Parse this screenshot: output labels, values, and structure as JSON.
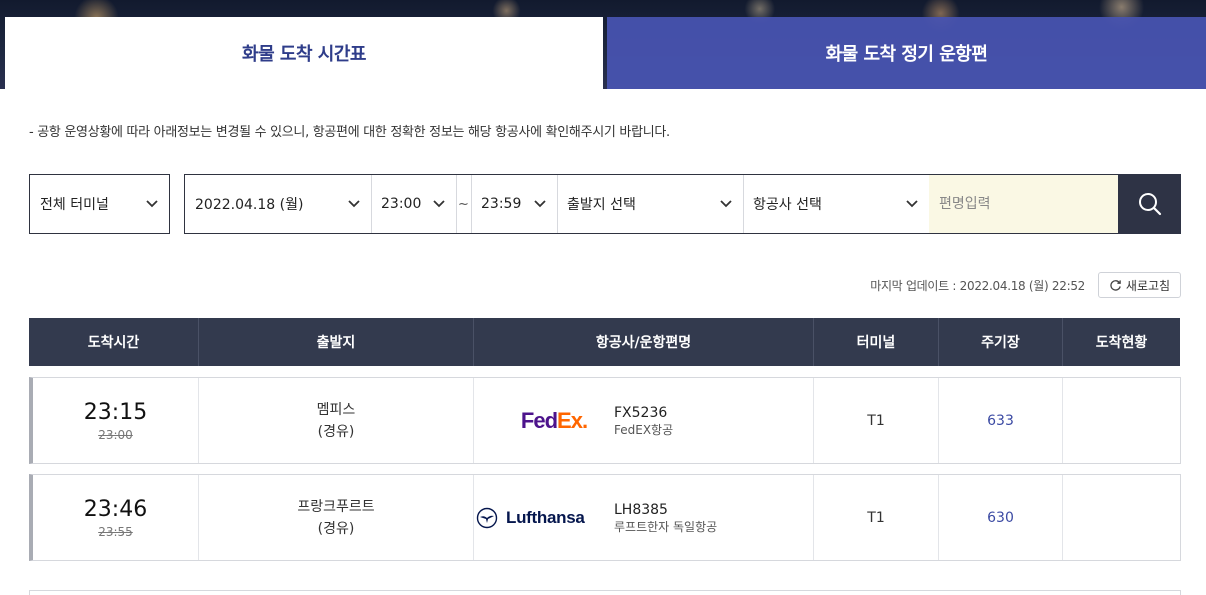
{
  "tabs": [
    {
      "label": "화물 도착 시간표",
      "active": true
    },
    {
      "label": "화물 도착 정기 운항편",
      "active": false
    }
  ],
  "notice": "-  공항 운영상황에 따라 아래정보는 변경될 수 있으니, 항공편에 대한 정확한 정보는 해당 항공사에 확인해주시기 바랍니다.",
  "filters": {
    "terminal": "전체 터미널",
    "date": "2022.04.18 (월)",
    "time_from": "23:00",
    "separator": "~",
    "time_to": "23:59",
    "origin": "출발지 선택",
    "airline": "항공사 선택",
    "flight_placeholder": "편명입력"
  },
  "last_update": "마지막 업데이트 : 2022.04.18 (월) 22:52",
  "refresh_label": "새로고침",
  "table": {
    "headers": [
      "도착시간",
      "출발지",
      "항공사/운항편명",
      "터미널",
      "주기장",
      "도착현황"
    ],
    "rows": [
      {
        "time": "23:15",
        "scheduled": "23:00",
        "origin": "멤피스",
        "via": "(경유)",
        "logo_text": "FedEx.",
        "flight_no": "FX5236",
        "airline": "FedEX항공",
        "terminal": "T1",
        "stand": "633",
        "status": ""
      },
      {
        "time": "23:46",
        "scheduled": "23:55",
        "origin": "프랑크푸르트",
        "via": "(경유)",
        "logo_text": "Lufthansa",
        "flight_no": "LH8385",
        "airline": "루프트한자 독일항공",
        "terminal": "T1",
        "stand": "630",
        "status": ""
      }
    ]
  },
  "colors": {
    "header_bg": "#333a4e",
    "active_tab_text": "#2f3d8a",
    "inactive_tab_bg": "#4854b2",
    "search_bg": "#2e3345",
    "input_bg": "#faf8e4",
    "fedex_purple": "#4d148c",
    "fedex_orange": "#ff6600",
    "lufthansa_blue": "#05164d"
  },
  "icons": {
    "search": "search-icon",
    "refresh": "refresh-icon",
    "dropdown": "chevron-down-icon",
    "lufthansa_crane": "crane-logo-icon"
  }
}
